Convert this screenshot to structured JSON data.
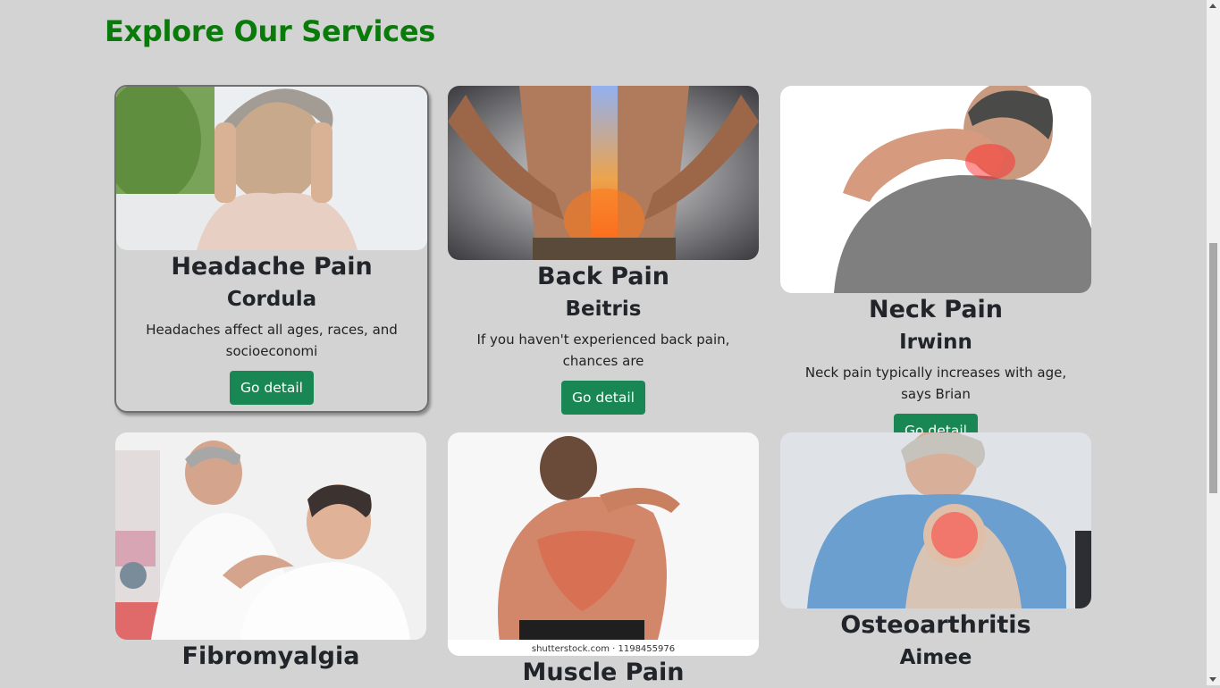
{
  "page": {
    "title": "Explore Our Services"
  },
  "cards": [
    {
      "title": "Headache Pain",
      "author": "Cordula",
      "desc": "Headaches affect all ages, races, and socioeconomi",
      "button": "Go detail",
      "image": "woman-headache-image"
    },
    {
      "title": "Back Pain",
      "author": "Beitris",
      "desc": "If you haven't experienced back pain, chances are",
      "button": "Go detail",
      "image": "back-pain-spine-image"
    },
    {
      "title": "Neck Pain",
      "author": "Irwinn",
      "desc": "Neck pain typically increases with age, says Brian",
      "button": "Go detail",
      "image": "neck-pain-man-image"
    },
    {
      "title": "Fibromyalgia",
      "author": "",
      "desc": "",
      "button": "",
      "image": "therapist-massage-image"
    },
    {
      "title": "Muscle Pain",
      "author": "",
      "desc": "",
      "button": "",
      "image": "muscle-back-image",
      "watermark": "shutterstock.com · 1198455976"
    },
    {
      "title": "Osteoarthritis",
      "author": "Aimee",
      "desc": "",
      "button": "",
      "image": "knee-pain-image"
    }
  ]
}
